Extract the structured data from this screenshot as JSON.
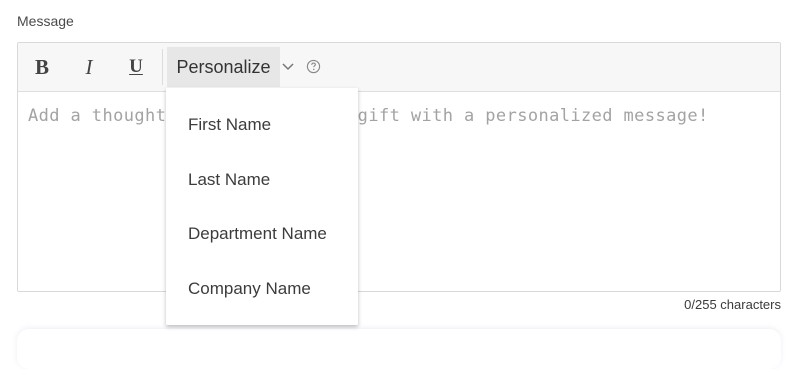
{
  "field": {
    "label": "Message"
  },
  "toolbar": {
    "bold_label": "B",
    "italic_label": "I",
    "underline_label": "U",
    "personalize_label": "Personalize",
    "icons": {
      "dropdown": "chevron-down-icon",
      "help": "question-circle-icon"
    }
  },
  "editor": {
    "value": "",
    "placeholder": "Add a thoughtful touch to your gift with a personalized message!"
  },
  "counter": {
    "text": "0/255 characters"
  },
  "personalize_menu": {
    "items": [
      {
        "label": "First Name"
      },
      {
        "label": "Last Name"
      },
      {
        "label": "Department Name"
      },
      {
        "label": "Company Name"
      }
    ]
  }
}
